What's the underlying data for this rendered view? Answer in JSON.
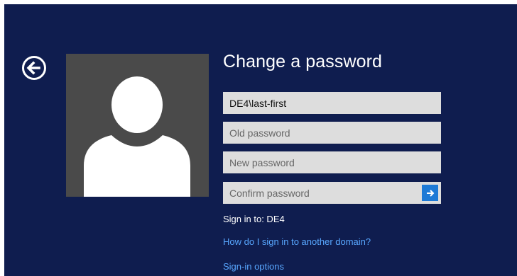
{
  "screen": {
    "title": "Change a password"
  },
  "icons": {
    "back": "back-arrow-circle-icon",
    "avatar": "user-avatar-icon",
    "submit": "arrow-right-icon"
  },
  "form": {
    "username": {
      "value": "DE4\\last-first",
      "placeholder": ""
    },
    "old_password": {
      "value": "",
      "placeholder": "Old password"
    },
    "new_password": {
      "value": "",
      "placeholder": "New password"
    },
    "confirm_password": {
      "value": "",
      "placeholder": "Confirm password"
    }
  },
  "info": {
    "sign_in_to": "Sign in to: DE4"
  },
  "links": {
    "domain_help": "How do I sign in to another domain?",
    "sign_in_options": "Sign-in options"
  },
  "colors": {
    "background": "#0f1d4f",
    "avatar_panel": "#4a4a4a",
    "field": "#dddddd",
    "accent": "#1e7ad6",
    "link": "#58a7ff"
  }
}
